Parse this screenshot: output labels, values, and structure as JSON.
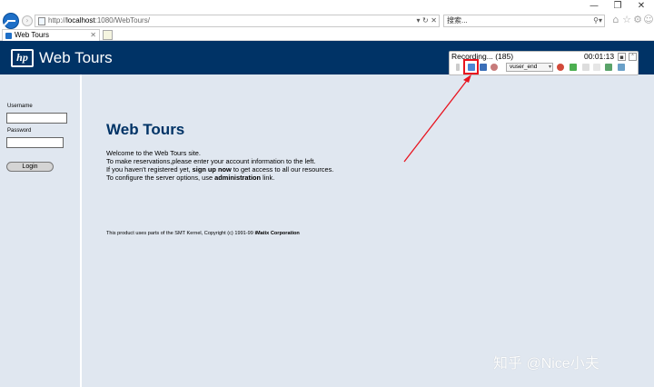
{
  "browser": {
    "address": {
      "url_prefix": "http://",
      "url_host": "localhost",
      "url_rest": ":1080/WebTours/",
      "url_tools": "▾ ↻ ✕"
    },
    "search": {
      "placeholder": "搜索...",
      "tools": "⚲▾"
    },
    "window_controls": {
      "minimize": "—",
      "restore": "❐",
      "close": "✕"
    },
    "tabs": [
      {
        "label": "Web Tours",
        "close": "✕"
      }
    ],
    "right_icons": {
      "home": "⌂",
      "favorites": "☆",
      "tools": "⚙",
      "feedback": "☺"
    }
  },
  "site": {
    "brand": "Web Tours",
    "logo_text": "hp",
    "colors": {
      "header": "#003366",
      "background": "#e0e7f0",
      "title": "#003366"
    }
  },
  "login": {
    "username_label": "Username",
    "password_label": "Password",
    "button": "Login"
  },
  "main": {
    "title": "Web Tours",
    "line1": "Welcome to the Web Tours site.",
    "line2": "To make reservations,please enter your account information to the left.",
    "line3_pre": "If you haven't registered yet, ",
    "line3_bold": "sign up now",
    "line3_post": " to get access to all our resources.",
    "line4_pre": "To configure the server options, use ",
    "line4_bold": "administration",
    "line4_post": " link.",
    "footnote_pre": "This product uses parts of the SMT Kernel, Copyright (c) 1991-99 ",
    "footnote_bold": "iMatix Corporation"
  },
  "recorder": {
    "title": "Recording... (185)",
    "time": "00:01:13",
    "transaction": "vuser_end",
    "controls": {
      "pin": "▪",
      "collapse": "˄"
    },
    "accent": "#e8141f"
  },
  "watermark": "知乎 @Nice小夫"
}
